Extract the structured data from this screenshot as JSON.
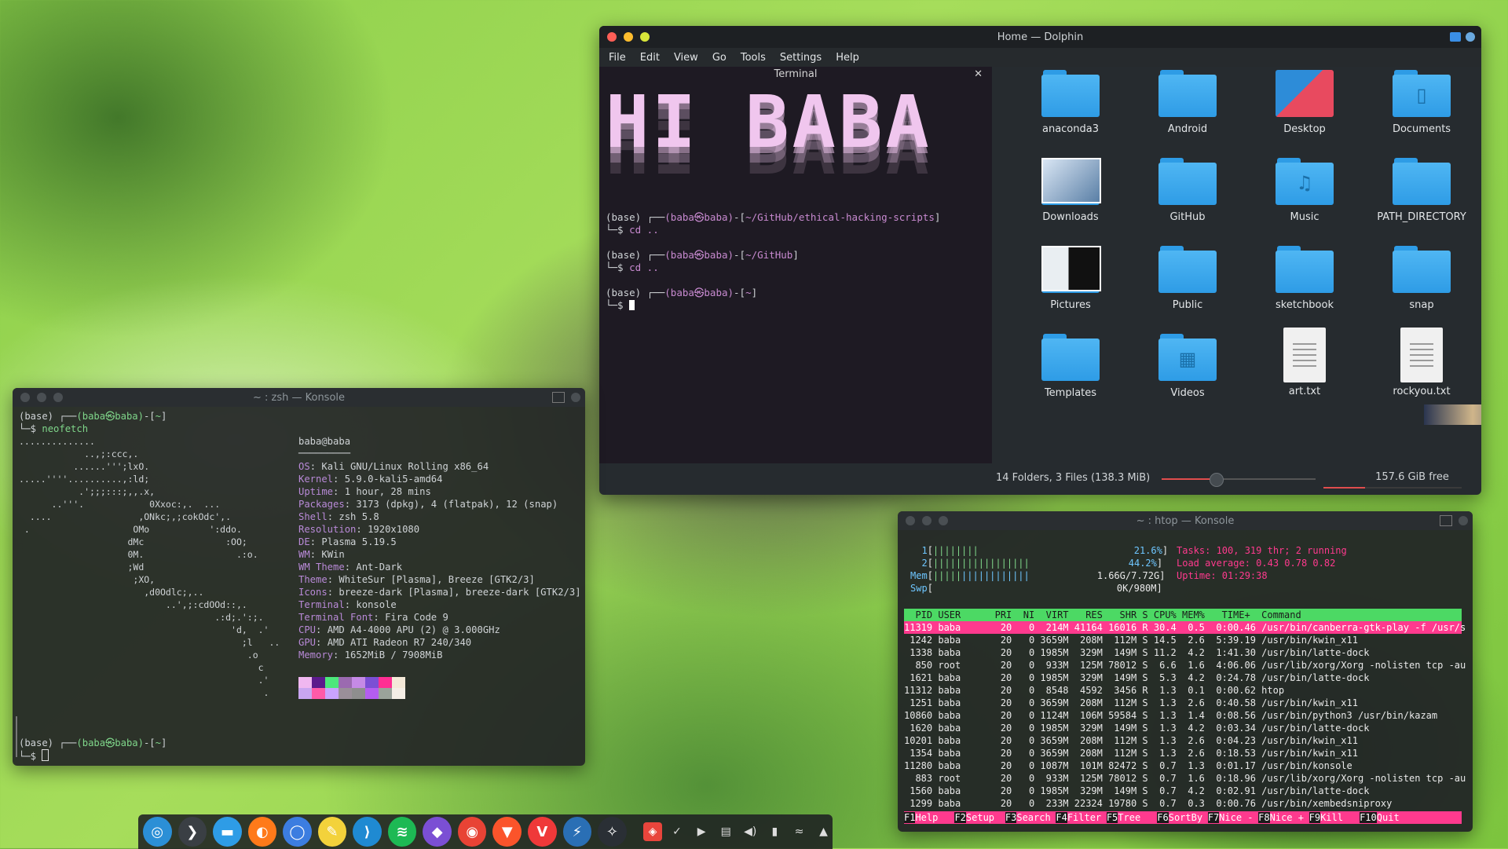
{
  "dolphin": {
    "title": "Home — Dolphin",
    "menu": [
      "File",
      "Edit",
      "View",
      "Go",
      "Tools",
      "Settings",
      "Help"
    ],
    "terminal_title": "Terminal",
    "banner": "HI BABA",
    "prompts": [
      {
        "env": "(base)",
        "user": "(baba㉿baba)",
        "path": "~/GitHub/ethical-hacking-scripts",
        "cmd": "cd .."
      },
      {
        "env": "(base)",
        "user": "(baba㉿baba)",
        "path": "~/GitHub",
        "cmd": "cd .."
      },
      {
        "env": "(base)",
        "user": "(baba㉿baba)",
        "path": "~",
        "cmd": ""
      }
    ],
    "files": [
      {
        "name": "anaconda3",
        "kind": "folder"
      },
      {
        "name": "Android",
        "kind": "folder"
      },
      {
        "name": "Desktop",
        "kind": "desktop"
      },
      {
        "name": "Documents",
        "kind": "folder"
      },
      {
        "name": "Downloads",
        "kind": "thumb"
      },
      {
        "name": "GitHub",
        "kind": "folder"
      },
      {
        "name": "Music",
        "kind": "folder-music"
      },
      {
        "name": "PATH_DIRECTORY",
        "kind": "folder"
      },
      {
        "name": "Pictures",
        "kind": "thumb"
      },
      {
        "name": "Public",
        "kind": "folder"
      },
      {
        "name": "sketchbook",
        "kind": "folder"
      },
      {
        "name": "snap",
        "kind": "folder"
      },
      {
        "name": "Templates",
        "kind": "folder"
      },
      {
        "name": "Videos",
        "kind": "folder-video"
      },
      {
        "name": "art.txt",
        "kind": "doc"
      },
      {
        "name": "rockyou.txt",
        "kind": "doc"
      }
    ],
    "status": "14 Folders, 3 Files (138.3 MiB)",
    "free": "157.6 GiB free",
    "zoom_level": 0.35
  },
  "neofetch_window": {
    "title": "~ : zsh — Konsole",
    "prompt_env": "(base)",
    "prompt_user": "(baba㉿baba)",
    "prompt_path": "~",
    "command": "neofetch",
    "logo": [
      "..............",
      "            ..,;:ccc,.",
      "          ......''';lxO.",
      ".....''''..........,:ld;",
      "           .';;;:::;,,.x,",
      "      ..'''.            0Xxoc:,.  ...",
      "  ....                ,ONkc;,;cokOdc',.",
      " .                   OMo           ':ddo.",
      "                    dMc               :OO;",
      "                    0M.                 .:o.",
      "                    ;Wd",
      "                     ;XO,",
      "                       ,d0Odlc;,..",
      "                           ..',;:cdOOd::,.",
      "                                    .:d;.':;.",
      "                                       'd,  .'",
      "                                         ;l   ..",
      "                                          .o",
      "                                            c",
      "                                            .'",
      "                                             ."
    ],
    "userhost": "baba@baba",
    "info": [
      {
        "k": "OS",
        "v": "Kali GNU/Linux Rolling x86_64"
      },
      {
        "k": "Kernel",
        "v": "5.9.0-kali5-amd64"
      },
      {
        "k": "Uptime",
        "v": "1 hour, 28 mins"
      },
      {
        "k": "Packages",
        "v": "3173 (dpkg), 4 (flatpak), 12 (snap)"
      },
      {
        "k": "Shell",
        "v": "zsh 5.8"
      },
      {
        "k": "Resolution",
        "v": "1920x1080"
      },
      {
        "k": "DE",
        "v": "Plasma 5.19.5"
      },
      {
        "k": "WM",
        "v": "KWin"
      },
      {
        "k": "WM Theme",
        "v": "Ant-Dark"
      },
      {
        "k": "Theme",
        "v": "WhiteSur [Plasma], Breeze [GTK2/3]"
      },
      {
        "k": "Icons",
        "v": "breeze-dark [Plasma], breeze-dark [GTK2/3]"
      },
      {
        "k": "Terminal",
        "v": "konsole"
      },
      {
        "k": "Terminal Font",
        "v": "Fira Code 9"
      },
      {
        "k": "CPU",
        "v": "AMD A4-4000 APU (2) @ 3.000GHz"
      },
      {
        "k": "GPU",
        "v": "AMD ATI Radeon R7 240/340"
      },
      {
        "k": "Memory",
        "v": "1652MiB / 7908MiB"
      }
    ],
    "palette_top": [
      "#f0b7f0",
      "#5c1a8c",
      "#4de87c",
      "#9b6ab0",
      "#c58ae6",
      "#7b4fd4",
      "#ff2e93",
      "#f4e9d8"
    ],
    "palette_bottom": [
      "#c9a5f0",
      "#ff5aa8",
      "#caa3ff",
      "#9a8f99",
      "#8e8e8e",
      "#b45df0",
      "#9aa39a",
      "#f5efe6"
    ],
    "prompt2_env": "(base)",
    "prompt2_user": "(baba㉿baba)",
    "prompt2_path": "~"
  },
  "htop_window": {
    "title": "~ : htop — Konsole",
    "cpu1": "21.6%",
    "cpu2": "44.2%",
    "mem": "1.66G/7.72G",
    "swp": "0K/980M",
    "tasks": "Tasks: 100, 319 thr; 2 running",
    "load": "Load average: 0.43 0.78 0.82",
    "uptime": "Uptime: 01:29:38",
    "header": "  PID USER      PRI  NI  VIRT   RES   SHR S CPU% MEM%   TIME+  Command",
    "rows": [
      "11319 baba       20   0  214M 41164 16016 R 30.4  0.5  0:00.46 /usr/bin/canberra-gtk-play -f /usr/s",
      " 1242 baba       20   0 3659M  208M  112M S 14.5  2.6  5:39.19 /usr/bin/kwin_x11",
      " 1338 baba       20   0 1985M  329M  149M S 11.2  4.2  1:41.30 /usr/bin/latte-dock",
      "  850 root       20   0  933M  125M 78012 S  6.6  1.6  4:06.06 /usr/lib/xorg/Xorg -nolisten tcp -au",
      " 1621 baba       20   0 1985M  329M  149M S  5.3  4.2  0:24.78 /usr/bin/latte-dock",
      "11312 baba       20   0  8548  4592  3456 R  1.3  0.1  0:00.62 htop",
      " 1251 baba       20   0 3659M  208M  112M S  1.3  2.6  0:40.58 /usr/bin/kwin_x11",
      "10860 baba       20   0 1124M  106M 59584 S  1.3  1.4  0:08.56 /usr/bin/python3 /usr/bin/kazam",
      " 1620 baba       20   0 1985M  329M  149M S  1.3  4.2  0:03.34 /usr/bin/latte-dock",
      "10201 baba       20   0 3659M  208M  112M S  1.3  2.6  0:04.23 /usr/bin/kwin_x11",
      " 1354 baba       20   0 3659M  208M  112M S  1.3  2.6  0:18.53 /usr/bin/kwin_x11",
      "11280 baba       20   0 1087M  101M 82472 S  0.7  1.3  0:01.17 /usr/bin/konsole",
      "  883 root       20   0  933M  125M 78012 S  0.7  1.6  0:18.96 /usr/lib/xorg/Xorg -nolisten tcp -au",
      " 1560 baba       20   0 1985M  329M  149M S  0.7  4.2  0:02.91 /usr/bin/latte-dock",
      " 1299 baba       20   0  233M 22324 19780 S  0.7  0.3  0:00.76 /usr/bin/xembedsniproxy"
    ],
    "fkeys": [
      {
        "k": "F1",
        "v": "Help"
      },
      {
        "k": "F2",
        "v": "Setup"
      },
      {
        "k": "F3",
        "v": "Search"
      },
      {
        "k": "F4",
        "v": "Filter"
      },
      {
        "k": "F5",
        "v": "Tree"
      },
      {
        "k": "F6",
        "v": "SortBy"
      },
      {
        "k": "F7",
        "v": "Nice -"
      },
      {
        "k": "F8",
        "v": "Nice +"
      },
      {
        "k": "F9",
        "v": "Kill"
      },
      {
        "k": "F10",
        "v": "Quit"
      }
    ]
  },
  "dock": {
    "apps": [
      {
        "name": "launcher-icon",
        "glyph": "◎",
        "color": "#2b8fd6"
      },
      {
        "name": "terminal-icon",
        "glyph": "❯",
        "color": "#3a3f44"
      },
      {
        "name": "file-manager-icon",
        "glyph": "▬",
        "color": "#2e9ce6"
      },
      {
        "name": "firefox-icon",
        "glyph": "◐",
        "color": "#ff7a1a"
      },
      {
        "name": "browser-icon",
        "glyph": "◯",
        "color": "#3c7de0"
      },
      {
        "name": "notes-icon",
        "glyph": "✎",
        "color": "#f3d23b"
      },
      {
        "name": "vscode-icon",
        "glyph": "⟩",
        "color": "#1f8ad2"
      },
      {
        "name": "spotify-icon",
        "glyph": "≋",
        "color": "#1db954"
      },
      {
        "name": "obsidian-icon",
        "glyph": "◆",
        "color": "#7b4fd4"
      },
      {
        "name": "chrome-icon",
        "glyph": "◉",
        "color": "#e84335"
      },
      {
        "name": "brave-icon",
        "glyph": "▼",
        "color": "#fb542b"
      },
      {
        "name": "vivaldi-icon",
        "glyph": "V",
        "color": "#ef3939"
      },
      {
        "name": "kali-icon",
        "glyph": "⚡",
        "color": "#2a6fb5"
      },
      {
        "name": "stellarium-icon",
        "glyph": "✧",
        "color": "#2a2f35"
      }
    ],
    "tray": [
      {
        "name": "anydesk-icon",
        "glyph": "◈"
      },
      {
        "name": "kdeconnect-icon",
        "glyph": "✓"
      },
      {
        "name": "media-icon",
        "glyph": "▶"
      },
      {
        "name": "clipboard-icon",
        "glyph": "▤"
      },
      {
        "name": "volume-icon",
        "glyph": "◀)"
      },
      {
        "name": "battery-icon",
        "glyph": "▮"
      },
      {
        "name": "wifi-icon",
        "glyph": "≈"
      },
      {
        "name": "expand-tray-icon",
        "glyph": "▲"
      }
    ]
  }
}
